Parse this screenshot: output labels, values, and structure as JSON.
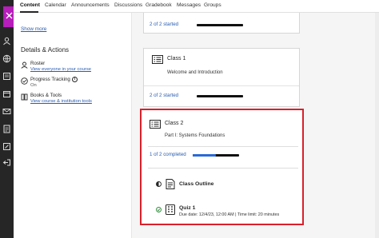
{
  "nav_rail": {
    "icons": [
      "close-icon",
      "user-icon",
      "globe-icon",
      "institution-icon",
      "calendar-icon",
      "mail-icon",
      "grades-icon",
      "tools-icon",
      "logout-icon"
    ]
  },
  "tabs": [
    "Content",
    "Calendar",
    "Announcements",
    "Discussions",
    "Gradebook",
    "Messages",
    "Groups"
  ],
  "active_tab": "Content",
  "left_panel": {
    "show_more": "Show more",
    "section_title": "Details & Actions",
    "items": [
      {
        "icon": "roster-icon",
        "label": "Roster",
        "link": "View everyone in your course"
      },
      {
        "icon": "progress-check-icon",
        "label": "Progress Tracking",
        "status": "On"
      },
      {
        "icon": "books-icon",
        "label": "Books & Tools",
        "link": "View course & institution tools"
      }
    ]
  },
  "cards": [
    {
      "progress": "2 of 2 started",
      "progress_fraction": 0.0
    },
    {
      "title": "Class 1",
      "subtitle": "Welcome and Introduction",
      "progress": "2 of 2 started",
      "progress_fraction": 0.0
    }
  ],
  "highlighted_class": {
    "title": "Class 2",
    "subtitle": "Part I: Systems Foundations",
    "progress": "1 of 2 completed",
    "progress_fraction": 0.5,
    "items": [
      {
        "title": "Class Outline",
        "state": "started",
        "type_icon": "document-icon"
      },
      {
        "title": "Quiz 1",
        "meta": "Due date: 12/4/23, 12:00 AM | Time limit: 20 minutes",
        "state": "completed",
        "type_icon": "quiz-icon"
      }
    ]
  },
  "colors": {
    "accent": "#b71eba",
    "link": "#2a5db0",
    "progress": "#2a6ad6",
    "highlight": "#d9202b",
    "complete": "#2e8b3a"
  }
}
